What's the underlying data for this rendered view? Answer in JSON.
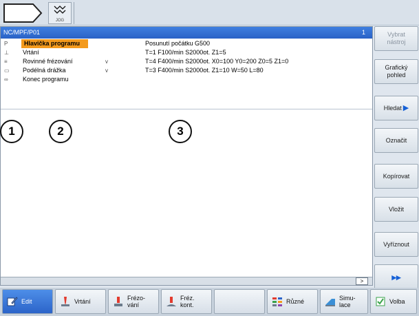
{
  "topbar": {
    "jog_label": "JOG"
  },
  "editor": {
    "path": "NC/MPF/P01",
    "page_num": "1",
    "lines": [
      {
        "icon": "P",
        "name": "Hlavička programu",
        "chev": "",
        "params": "Posunutí počátku G500",
        "selected": true
      },
      {
        "icon": "⊥",
        "name": "Vrtání",
        "chev": "",
        "params": "T=1 F100/min S2000ot. Z1=5",
        "selected": false
      },
      {
        "icon": "≡",
        "name": "Rovinné frézování",
        "chev": "v",
        "params": "T=4 F400/min S2000ot. X0=100 Y0=200 Z0=5 Z1=0",
        "selected": false
      },
      {
        "icon": "▭",
        "name": "Podélná drážka",
        "chev": "v",
        "params": "T=3 F400/min S2000ot. Z1=10 W=50 L=80",
        "selected": false
      },
      {
        "icon": "∞",
        "name": "Konec programu",
        "chev": "",
        "params": "",
        "selected": false
      }
    ],
    "scroll_label": ">"
  },
  "callouts": [
    "1",
    "2",
    "3"
  ],
  "right_softkeys": [
    {
      "label": "Vybrat nástroj",
      "disabled": true
    },
    {
      "label": "Grafický pohled",
      "disabled": false
    },
    {
      "label": "Hledat",
      "disabled": false
    },
    {
      "label": "Označit",
      "disabled": false
    },
    {
      "label": "Kopírovat",
      "disabled": false
    },
    {
      "label": "Vložit",
      "disabled": false
    },
    {
      "label": "Vyříznout",
      "disabled": false
    },
    {
      "label": "▸▸",
      "disabled": false
    }
  ],
  "bottom_softkeys": [
    {
      "label": "Edit",
      "icon": "edit-icon"
    },
    {
      "label": "Vrtání",
      "icon": "drill-icon"
    },
    {
      "label": "Frézo-\nvání",
      "icon": "milling-icon"
    },
    {
      "label": "Fréz.\nkont.",
      "icon": "contour-milling-icon"
    },
    {
      "label": "",
      "icon": ""
    },
    {
      "label": "Různé",
      "icon": "misc-icon"
    },
    {
      "label": "Simu-\nlace",
      "icon": "simulation-icon"
    },
    {
      "label": "Volba",
      "icon": "select-icon"
    }
  ],
  "colors": {
    "title_bar": "#2f6cd2",
    "selection": "#f39a1d",
    "active_key": "#3a78dc"
  }
}
